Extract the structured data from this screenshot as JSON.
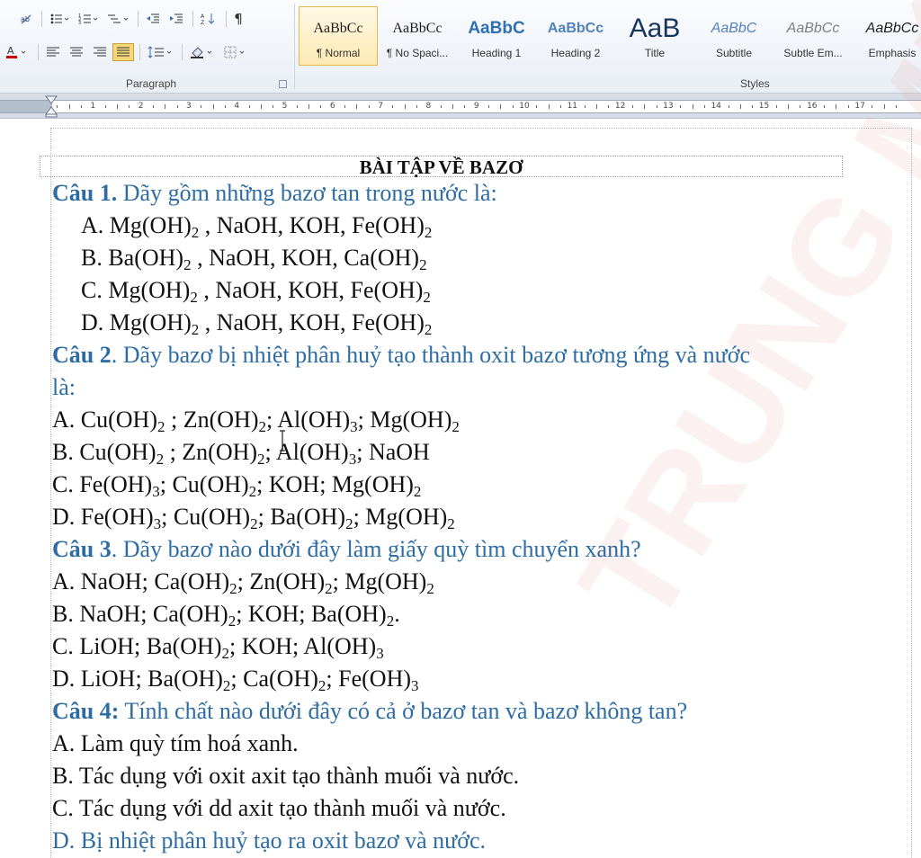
{
  "ribbon": {
    "paragraph_group_label": "Paragraph",
    "styles_group_label": "Styles",
    "para_row1_icons": [
      "bullets-icon",
      "numbering-icon",
      "multilevel-list-icon",
      "decrease-indent-icon",
      "increase-indent-icon",
      "sort-icon",
      "show-formatting-icon"
    ],
    "para_row2_icons": [
      "align-left-icon",
      "align-center-icon",
      "align-right-icon",
      "justify-icon",
      "line-spacing-icon",
      "shading-icon",
      "borders-icon"
    ],
    "styles": [
      {
        "sample": "AaBbCc",
        "name": "¶ Normal",
        "selected": true,
        "color": "#1f1f1f",
        "size": 16,
        "bold": false,
        "italic": false,
        "family": "Liberation Serif"
      },
      {
        "sample": "AaBbCc",
        "name": "¶ No Spaci...",
        "selected": false,
        "color": "#1f1f1f",
        "size": 16,
        "bold": false,
        "italic": false,
        "family": "Liberation Serif"
      },
      {
        "sample": "AaBbC",
        "name": "Heading 1",
        "selected": false,
        "color": "#2f6fb3",
        "size": 19,
        "bold": true,
        "italic": false,
        "family": "Liberation Sans"
      },
      {
        "sample": "AaBbCc",
        "name": "Heading 2",
        "selected": false,
        "color": "#4f81bd",
        "size": 16,
        "bold": true,
        "italic": false,
        "family": "Liberation Sans"
      },
      {
        "sample": "AaB",
        "name": "Title",
        "selected": false,
        "color": "#17365d",
        "size": 30,
        "bold": false,
        "italic": false,
        "family": "Liberation Sans"
      },
      {
        "sample": "AaBbC",
        "name": "Subtitle",
        "selected": false,
        "color": "#4f81bd",
        "size": 16,
        "bold": false,
        "italic": true,
        "family": "Liberation Sans"
      },
      {
        "sample": "AaBbCc",
        "name": "Subtle Em...",
        "selected": false,
        "color": "#7f7f7f",
        "size": 16,
        "bold": false,
        "italic": true,
        "family": "Liberation Sans"
      },
      {
        "sample": "AaBbCc",
        "name": "Emphasis",
        "selected": false,
        "color": "#1f1f1f",
        "size": 16,
        "bold": false,
        "italic": true,
        "family": "Liberation Sans"
      }
    ]
  },
  "ruler": {
    "numbers": [
      "1",
      "2",
      "3",
      "4",
      "5",
      "6",
      "7",
      "8",
      "9",
      "10",
      "11",
      "12",
      "13",
      "14",
      "15",
      "16",
      "17"
    ]
  },
  "document": {
    "title": "BÀI TẬP VỀ BAZƠ",
    "questions": [
      {
        "label": "Câu 1.",
        "text": " Dãy gồm những bazơ tan trong nước là:",
        "options": [
          {
            "letter": "A.",
            "text": "Mg(OH)<sub>2</sub> , NaOH, KOH, Fe(OH)<sub>2</sub>"
          },
          {
            "letter": "B.",
            "text": "Ba(OH)<sub>2</sub> , NaOH, KOH, Ca(OH)<sub>2</sub>"
          },
          {
            "letter": "C.",
            "text": "Mg(OH)<sub>2</sub> , NaOH, KOH, Fe(OH)<sub>2</sub>"
          },
          {
            "letter": "D.",
            "text": "Mg(OH)<sub>2</sub> , NaOH, KOH, Fe(OH)<sub>2</sub>"
          }
        ]
      },
      {
        "label": "Câu 2",
        "text": ". Dãy bazơ  bị nhiệt phân huỷ tạo thành oxit bazơ tương ứng và nước",
        "continuation": "là:",
        "options": [
          {
            "letter": "A.",
            "text": "Cu(OH)<sub>2</sub> ; Zn(OH)<sub>2</sub>; Al(OH)<sub>3</sub>; Mg(OH)<sub>2</sub>"
          },
          {
            "letter": "B.",
            "text": "Cu(OH)<sub>2</sub> ; Zn(OH)<sub>2</sub>; Al(OH)<sub>3</sub>; NaOH"
          },
          {
            "letter": "C.",
            "text": "Fe(OH)<sub>3</sub>; Cu(OH)<sub>2</sub>; KOH; Mg(OH)<sub>2</sub>"
          },
          {
            "letter": "D.",
            "text": "Fe(OH)<sub>3</sub>; Cu(OH)<sub>2</sub>; Ba(OH)<sub>2</sub>; Mg(OH)<sub>2</sub>"
          }
        ]
      },
      {
        "label": "Câu 3",
        "text": ". Dãy bazơ nào dưới đây làm giấy quỳ tìm chuyển xanh?",
        "options": [
          {
            "letter": "A.",
            "text": "NaOH; Ca(OH)<sub>2</sub>; Zn(OH)<sub>2</sub>; Mg(OH)<sub>2</sub>"
          },
          {
            "letter": "B.",
            "text": "NaOH; Ca(OH)<sub>2</sub>; KOH; Ba(OH)<sub>2</sub>."
          },
          {
            "letter": "C.",
            "text": "LiOH; Ba(OH)<sub>2</sub>; KOH; Al(OH)<sub>3</sub>"
          },
          {
            "letter": "D.",
            "text": "LiOH; Ba(OH)<sub>2</sub>; Ca(OH)<sub>2</sub>; Fe(OH)<sub>3</sub>"
          }
        ]
      },
      {
        "label": "Câu 4:",
        "text": " Tính chất nào dưới đây có cả ở bazơ tan và  bazơ không tan?",
        "options": [
          {
            "letter": "A.",
            "text": "Làm quỳ tím hoá xanh."
          },
          {
            "letter": "B.",
            "text": "Tác dụng với oxit axit tạo thành muối  và nước."
          },
          {
            "letter": "C.",
            "text": "Tác dụng với dd axit tạo thành muối và nước."
          },
          {
            "letter": "D.",
            "text": "Bị nhiệt phân huỷ tạo ra oxit bazơ và nước.",
            "color": "#2e6da4"
          }
        ]
      }
    ]
  },
  "colors": {
    "question_blue": "#2e6da4",
    "selected_style_bg": "#fde9b3",
    "active_button": "#f6d775"
  }
}
